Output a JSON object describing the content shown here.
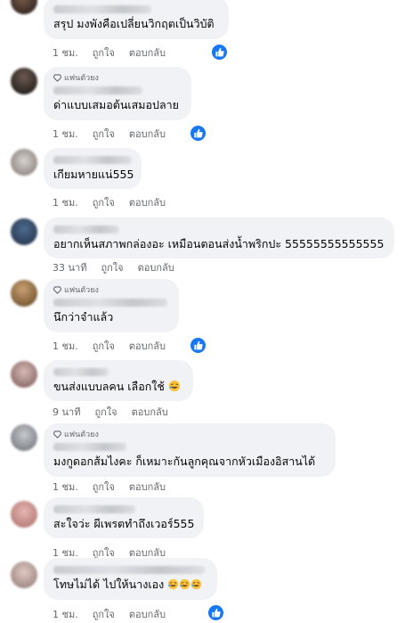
{
  "strings": {
    "fan_badge": "แฟนตัวยง",
    "like": "ถูกใจ",
    "reply": "ตอบกลับ"
  },
  "colors": {
    "like_badge": "#1877f2",
    "bubble": "#f0f2f5",
    "meta_text": "#65676b"
  },
  "comments": [
    {
      "text": "สรุป มงพังคือเปลี่ยนวิกฤตเป็นวิบัติ",
      "time": "1 ชม.",
      "has_like_badge": true
    },
    {
      "text": "ด่าแบบเสมอต้นเสมอปลาย",
      "time": "1 ชม.",
      "fan": true,
      "has_like_badge": true
    },
    {
      "text": "เกียมหายแน่555",
      "time": "1 ชม.",
      "has_like_badge": false
    },
    {
      "text": "อยากเห็นสภาพกล่องอะ เหมือนตอนส่งน้ำพริกปะ 55555555555555",
      "time": "33 นาที",
      "has_like_badge": false
    },
    {
      "text": "นึกว่าจำแล้ว",
      "time": "1 ชม.",
      "fan": true,
      "has_like_badge": true
    },
    {
      "text": "ขนส่งแบบลคน เลือกใช้",
      "time": "9 นาที",
      "emoji": "rofl",
      "has_like_badge": false
    },
    {
      "text": "มงกูดอกส้มไงคะ ก็เหมาะกันลูกคุณจากหัวเมืองอิสานได้",
      "time": "1 ชม.",
      "fan": true,
      "has_like_badge": false
    },
    {
      "text": "สะใจว่ะ ผีเพรตทำถึงเวอร์555",
      "time": "1 ชม.",
      "has_like_badge": false
    },
    {
      "text": "โทษไม่ได้ ไปให้นางเอง",
      "time": "1 ชม.",
      "emoji": "rofl-x3",
      "has_like_badge": true
    }
  ]
}
